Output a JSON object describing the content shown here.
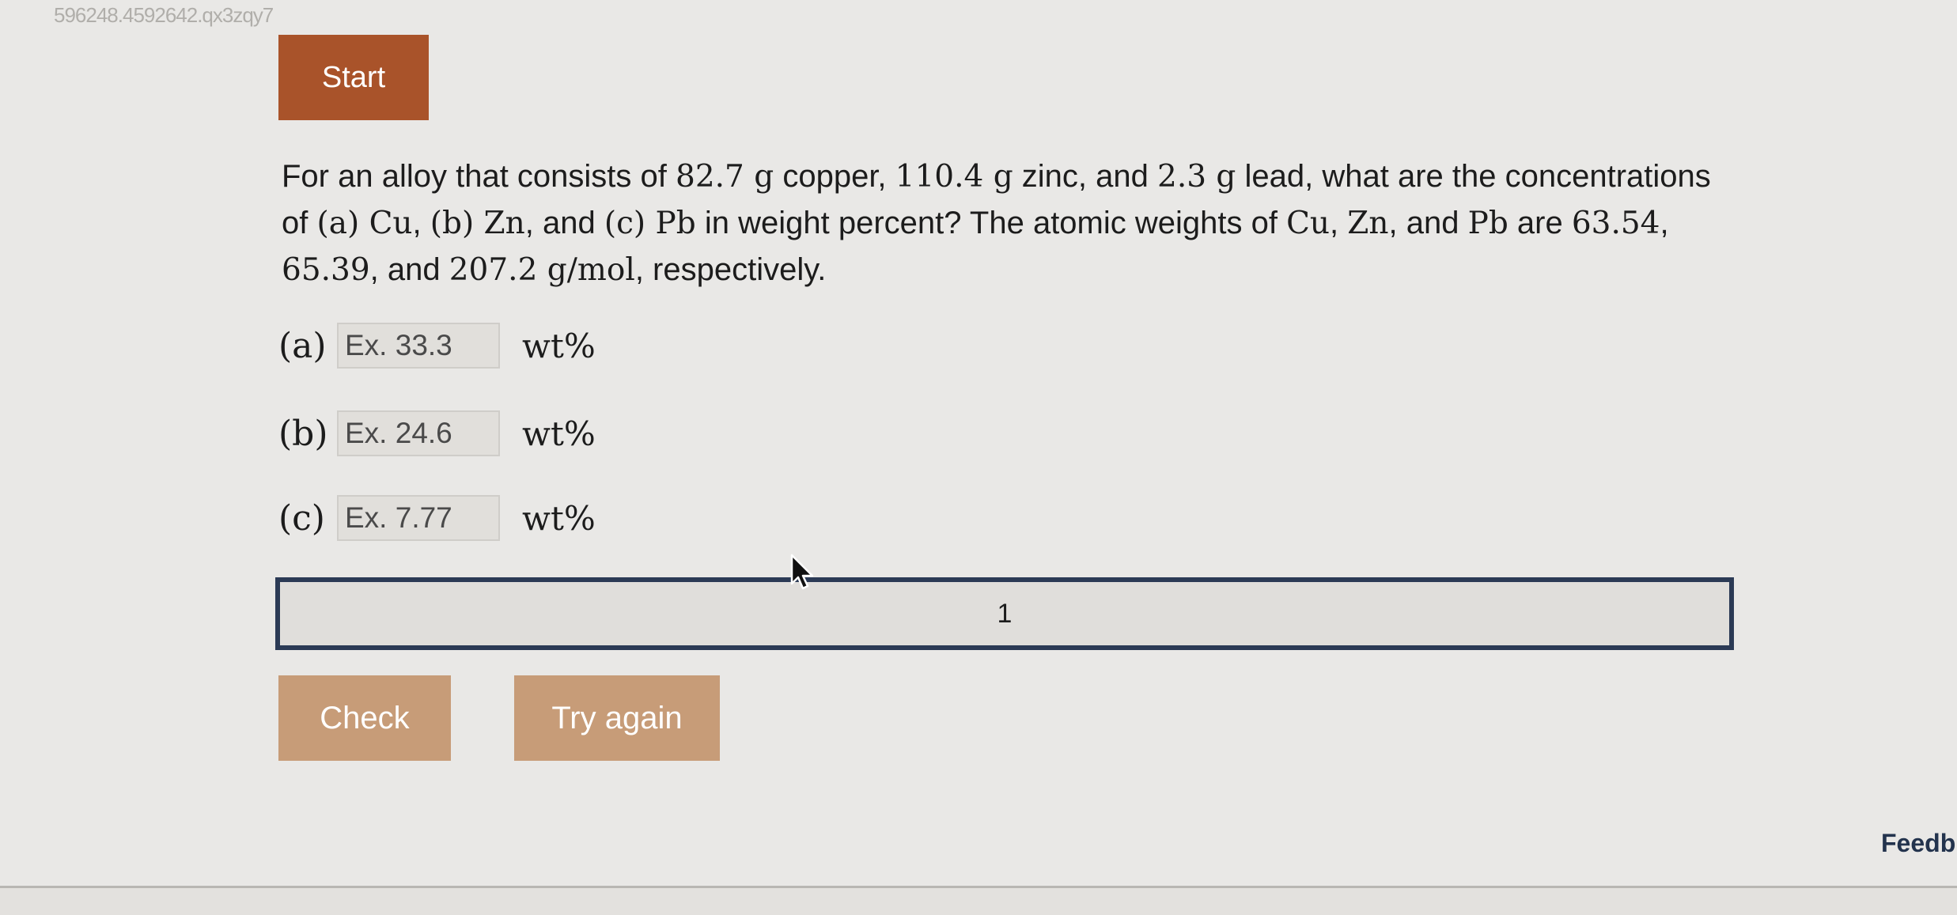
{
  "activity_id": "596248.4592642.qx3zqy7",
  "start_label": "Start",
  "question": {
    "parts": [
      {
        "t": "For an alloy that consists of "
      },
      {
        "m": "82.7 g"
      },
      {
        "t": " copper, "
      },
      {
        "m": "110.4 g"
      },
      {
        "t": " zinc, and "
      },
      {
        "m": "2.3 g"
      },
      {
        "t": " lead, what are the concentrations of "
      },
      {
        "m": "(a) Cu"
      },
      {
        "t": ", "
      },
      {
        "m": "(b) Zn"
      },
      {
        "t": ", and "
      },
      {
        "m": "(c) Pb"
      },
      {
        "t": " in weight percent? The atomic weights of "
      },
      {
        "m": "Cu"
      },
      {
        "t": ", "
      },
      {
        "m": "Zn"
      },
      {
        "t": ", and "
      },
      {
        "m": "Pb"
      },
      {
        "t": " are "
      },
      {
        "m": "63.54"
      },
      {
        "t": ", "
      },
      {
        "m": "65.39"
      },
      {
        "t": ", and "
      },
      {
        "m": "207.2 g/mol"
      },
      {
        "t": ", respectively."
      }
    ]
  },
  "answers": [
    {
      "label": "(a)",
      "placeholder": "Ex. 33.3",
      "value": "",
      "unit": "wt%"
    },
    {
      "label": "(b)",
      "placeholder": "Ex. 24.6",
      "value": "",
      "unit": "wt%"
    },
    {
      "label": "(c)",
      "placeholder": "Ex. 7.77",
      "value": "",
      "unit": "wt%"
    }
  ],
  "progress": {
    "level": "1"
  },
  "buttons": {
    "check": "Check",
    "try_again": "Try again"
  },
  "feedback_label": "Feedb",
  "colors": {
    "start_button": "#a9532a",
    "action_button": "#c79c78",
    "progress_border": "#2b3a55",
    "feedback_link": "#23334d"
  },
  "icons": {
    "cursor": "mouse-pointer-icon"
  }
}
